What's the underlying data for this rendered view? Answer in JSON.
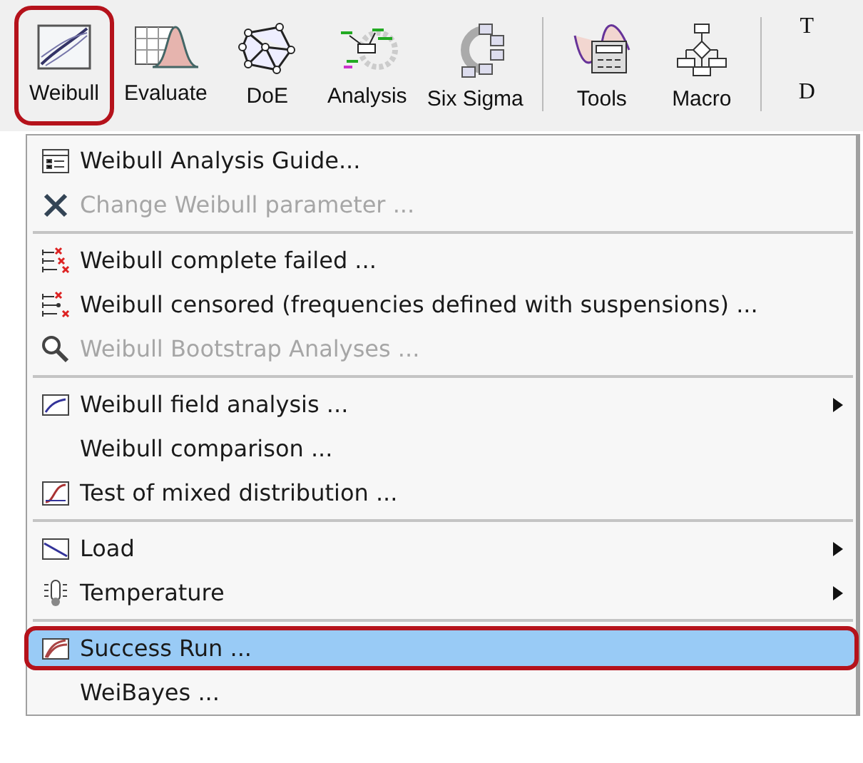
{
  "toolbar": {
    "buttons": [
      {
        "label": "Weibull",
        "callout": true,
        "group_end": false
      },
      {
        "label": "Evaluate",
        "callout": false,
        "group_end": false
      },
      {
        "label": "DoE",
        "callout": false,
        "group_end": false
      },
      {
        "label": "Analysis",
        "callout": false,
        "group_end": false
      },
      {
        "label": "Six Sigma",
        "callout": false,
        "group_end": true
      },
      {
        "label": "Tools",
        "callout": false,
        "group_end": false
      },
      {
        "label": "Macro",
        "callout": false,
        "group_end": true
      }
    ],
    "cut_button": {
      "glyph": "T",
      "label": "D"
    }
  },
  "menu": {
    "items": [
      {
        "kind": "item",
        "label": "Weibull Analysis Guide...",
        "disabled": false,
        "submenu": false,
        "selected": false,
        "callout": false
      },
      {
        "kind": "item",
        "label": "Change Weibull parameter ...",
        "disabled": true,
        "submenu": false,
        "selected": false,
        "callout": false
      },
      {
        "kind": "separator"
      },
      {
        "kind": "item",
        "label": "Weibull complete failed ...",
        "disabled": false,
        "submenu": false,
        "selected": false,
        "callout": false
      },
      {
        "kind": "item",
        "label": "Weibull censored (frequencies defined with suspensions) ...",
        "disabled": false,
        "submenu": false,
        "selected": false,
        "callout": false
      },
      {
        "kind": "item",
        "label": "Weibull Bootstrap Analyses ...",
        "disabled": true,
        "submenu": false,
        "selected": false,
        "callout": false
      },
      {
        "kind": "separator"
      },
      {
        "kind": "item",
        "label": "Weibull field analysis ...",
        "disabled": false,
        "submenu": true,
        "selected": false,
        "callout": false
      },
      {
        "kind": "item",
        "label": "Weibull comparison ...",
        "disabled": false,
        "submenu": false,
        "selected": false,
        "callout": false
      },
      {
        "kind": "item",
        "label": "Test of mixed distribution ...",
        "disabled": false,
        "submenu": false,
        "selected": false,
        "callout": false
      },
      {
        "kind": "separator"
      },
      {
        "kind": "item",
        "label": "Load",
        "disabled": false,
        "submenu": true,
        "selected": false,
        "callout": false
      },
      {
        "kind": "item",
        "label": "Temperature",
        "disabled": false,
        "submenu": true,
        "selected": false,
        "callout": false
      },
      {
        "kind": "separator"
      },
      {
        "kind": "item",
        "label": "Success Run ...",
        "disabled": false,
        "submenu": false,
        "selected": true,
        "callout": true
      },
      {
        "kind": "item",
        "label": "WeiBayes ...",
        "disabled": false,
        "submenu": false,
        "selected": false,
        "callout": false
      }
    ]
  }
}
